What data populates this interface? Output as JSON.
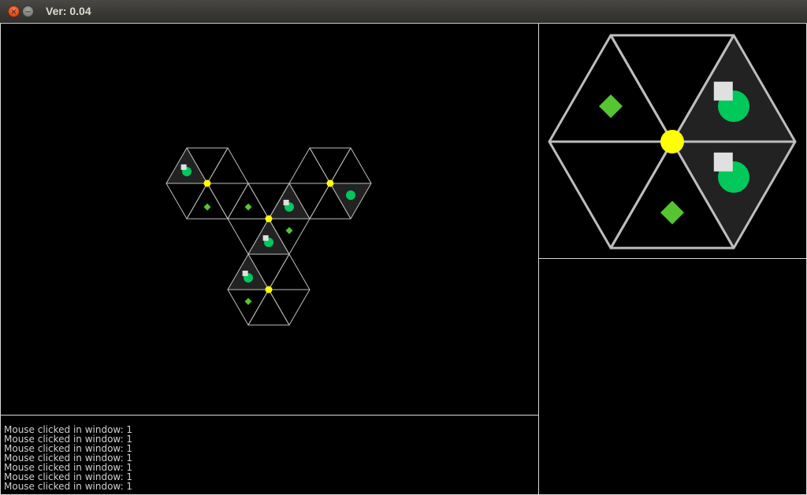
{
  "window": {
    "title": "Ver: 0.04",
    "close_icon": "close-icon",
    "minimize_icon": "minimize-icon"
  },
  "colors": {
    "background": "#000000",
    "grid_line": "#bdbdbd",
    "filled_triangle": "#222222",
    "vertex_node": "#ffff00",
    "green_circle": "#00c85a",
    "green_diamond": "#55c532",
    "white_square": "#e0e0e0"
  },
  "board": {
    "hexes": [
      {
        "id": "hex-top-left",
        "filled": [
          2
        ],
        "pieces": [
          {
            "tri": 4,
            "type": "diamond"
          },
          {
            "tri": 2,
            "type": "circle-square"
          }
        ]
      },
      {
        "id": "hex-top-right",
        "filled": [
          5
        ],
        "pieces": [
          {
            "tri": 5,
            "type": "circle"
          }
        ]
      },
      {
        "id": "hex-middle",
        "filled": [
          0,
          4
        ],
        "pieces": [
          {
            "tri": 4,
            "type": "circle-square"
          },
          {
            "tri": 5,
            "type": "diamond"
          },
          {
            "tri": 2,
            "type": "diamond"
          },
          {
            "tri": 0,
            "type": "circle-square"
          }
        ]
      },
      {
        "id": "hex-bottom",
        "filled": [
          2
        ],
        "pieces": [
          {
            "tri": 3,
            "type": "diamond"
          },
          {
            "tri": 2,
            "type": "circle-square"
          }
        ]
      }
    ]
  },
  "zoom_hex": {
    "filled": [
      5,
      0
    ],
    "pieces": [
      {
        "tri": 5,
        "type": "circle-square"
      },
      {
        "tri": 4,
        "type": "diamond"
      },
      {
        "tri": 2,
        "type": "diamond"
      },
      {
        "tri": 0,
        "type": "circle-square"
      }
    ]
  },
  "console": {
    "lines": [
      "Mouse clicked in window: 1",
      "Mouse clicked in window: 1",
      "Mouse clicked in window: 1",
      "Mouse clicked in window: 1",
      "Mouse clicked in window: 1",
      "Mouse clicked in window: 1",
      "Mouse clicked in window: 1"
    ]
  }
}
